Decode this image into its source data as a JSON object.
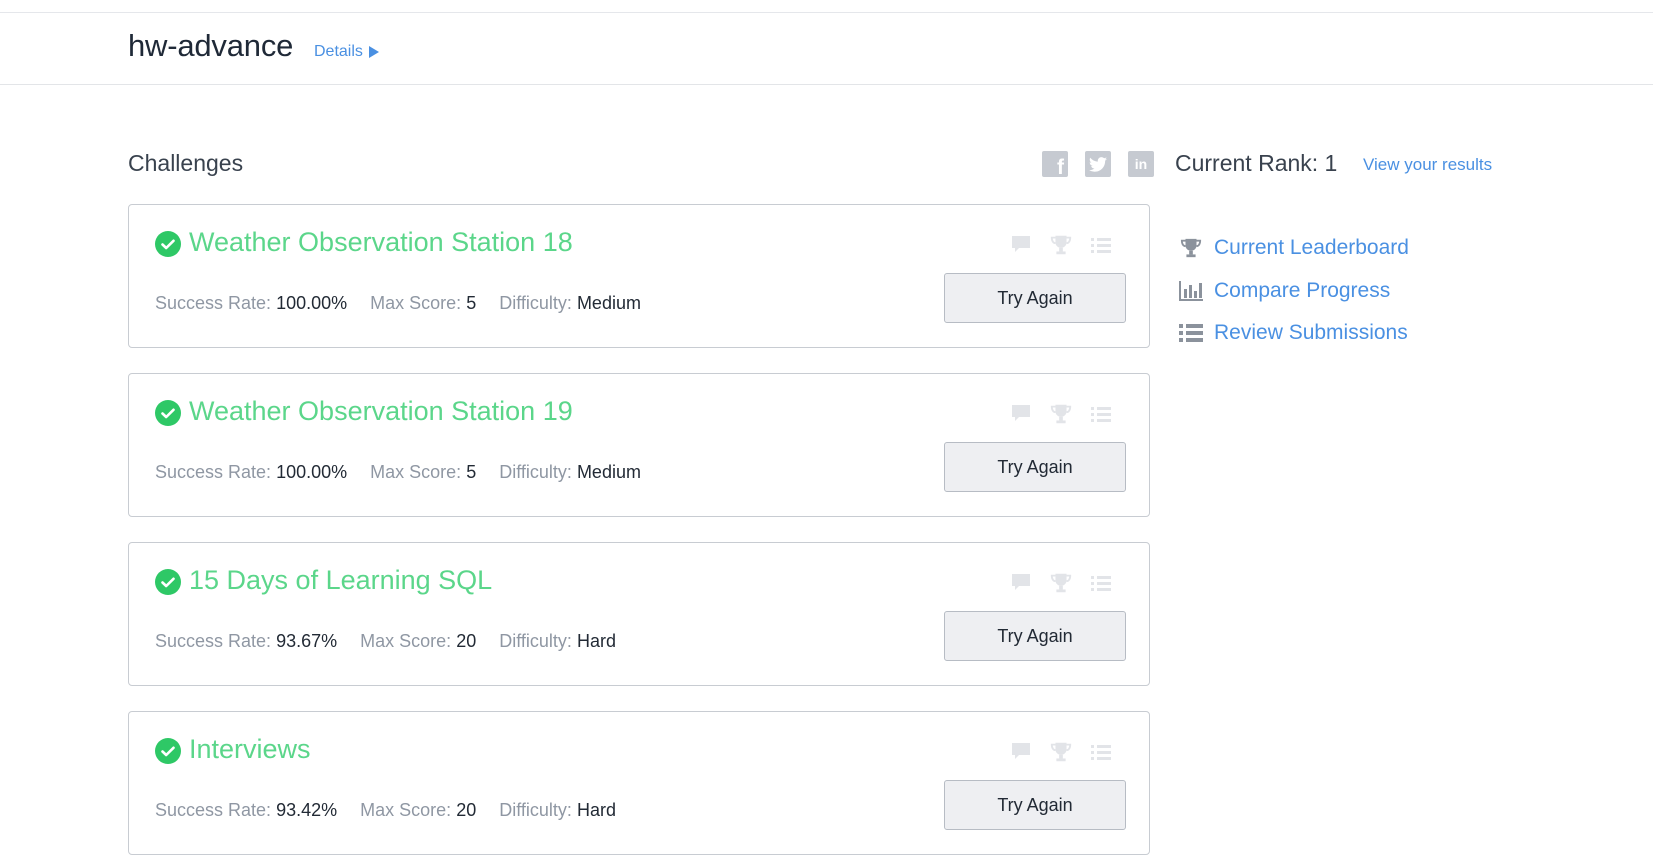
{
  "contest": {
    "name": "hw-advance",
    "details_label": "Details"
  },
  "challenges_heading": "Challenges",
  "share": {
    "facebook": "f",
    "linkedin": "in"
  },
  "rank": {
    "text": "Current Rank: 1",
    "view_results": "View your results"
  },
  "sidebar": {
    "leaderboard": "Current Leaderboard",
    "compare": "Compare Progress",
    "submissions": "Review Submissions"
  },
  "labels": {
    "success_rate": "Success Rate:",
    "max_score": "Max Score:",
    "difficulty": "Difficulty:"
  },
  "challenges": [
    {
      "title": "Weather Observation Station 18",
      "success_rate": "100.00%",
      "max_score": "5",
      "difficulty": "Medium",
      "button": "Try Again"
    },
    {
      "title": "Weather Observation Station 19",
      "success_rate": "100.00%",
      "max_score": "5",
      "difficulty": "Medium",
      "button": "Try Again"
    },
    {
      "title": "15 Days of Learning SQL",
      "success_rate": "93.67%",
      "max_score": "20",
      "difficulty": "Hard",
      "button": "Try Again"
    },
    {
      "title": "Interviews",
      "success_rate": "93.42%",
      "max_score": "20",
      "difficulty": "Hard",
      "button": "Try Again"
    }
  ],
  "colors": {
    "accent": "#4a90e2",
    "solved": "#2ec866",
    "title_solved": "#5bd68a"
  }
}
